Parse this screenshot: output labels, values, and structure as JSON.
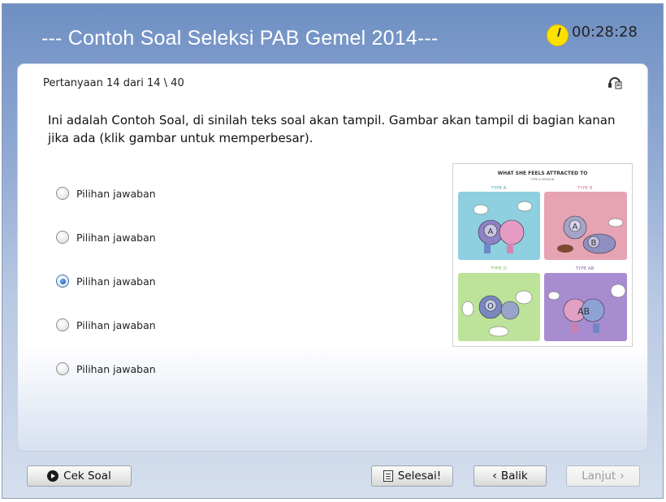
{
  "header": {
    "title": "--- Contoh Soal Seleksi PAB Gemel 2014---",
    "timer": "00:28:28",
    "timer_icon": "clock-icon",
    "timer_icon_color": "#ffe100"
  },
  "question": {
    "counter": "Pertanyaan 14 dari 14 \\ 40",
    "text": "Ini adalah Contoh Soal, di sinilah teks soal akan tampil. Gambar akan tampil di bagian kanan jika ada (klik gambar untuk memperbesar).",
    "help_icon": "help-icon",
    "options": [
      {
        "label": "Pilihan jawaban",
        "selected": false
      },
      {
        "label": "Pilihan jawaban",
        "selected": false
      },
      {
        "label": "Pilihan jawaban",
        "selected": true
      },
      {
        "label": "Pilihan jawaban",
        "selected": false
      },
      {
        "label": "Pilihan jawaban",
        "selected": false
      }
    ],
    "image": {
      "title": "WHAT SHE FEELS ATTRACTED TO",
      "subtitle": "TYPE A VERSION",
      "panels": [
        "TYPE A",
        "TYPE B",
        "TYPE O",
        "TYPE AB"
      ],
      "colors": [
        "#8ecfe0",
        "#e6a3b3",
        "#bde39a",
        "#a88cd0"
      ]
    }
  },
  "footer": {
    "cek_soal": "Cek Soal",
    "selesai": "Selesai!",
    "balik": "Balik",
    "lanjut": "Lanjut",
    "balik_prefix": "‹",
    "lanjut_suffix": "›"
  }
}
